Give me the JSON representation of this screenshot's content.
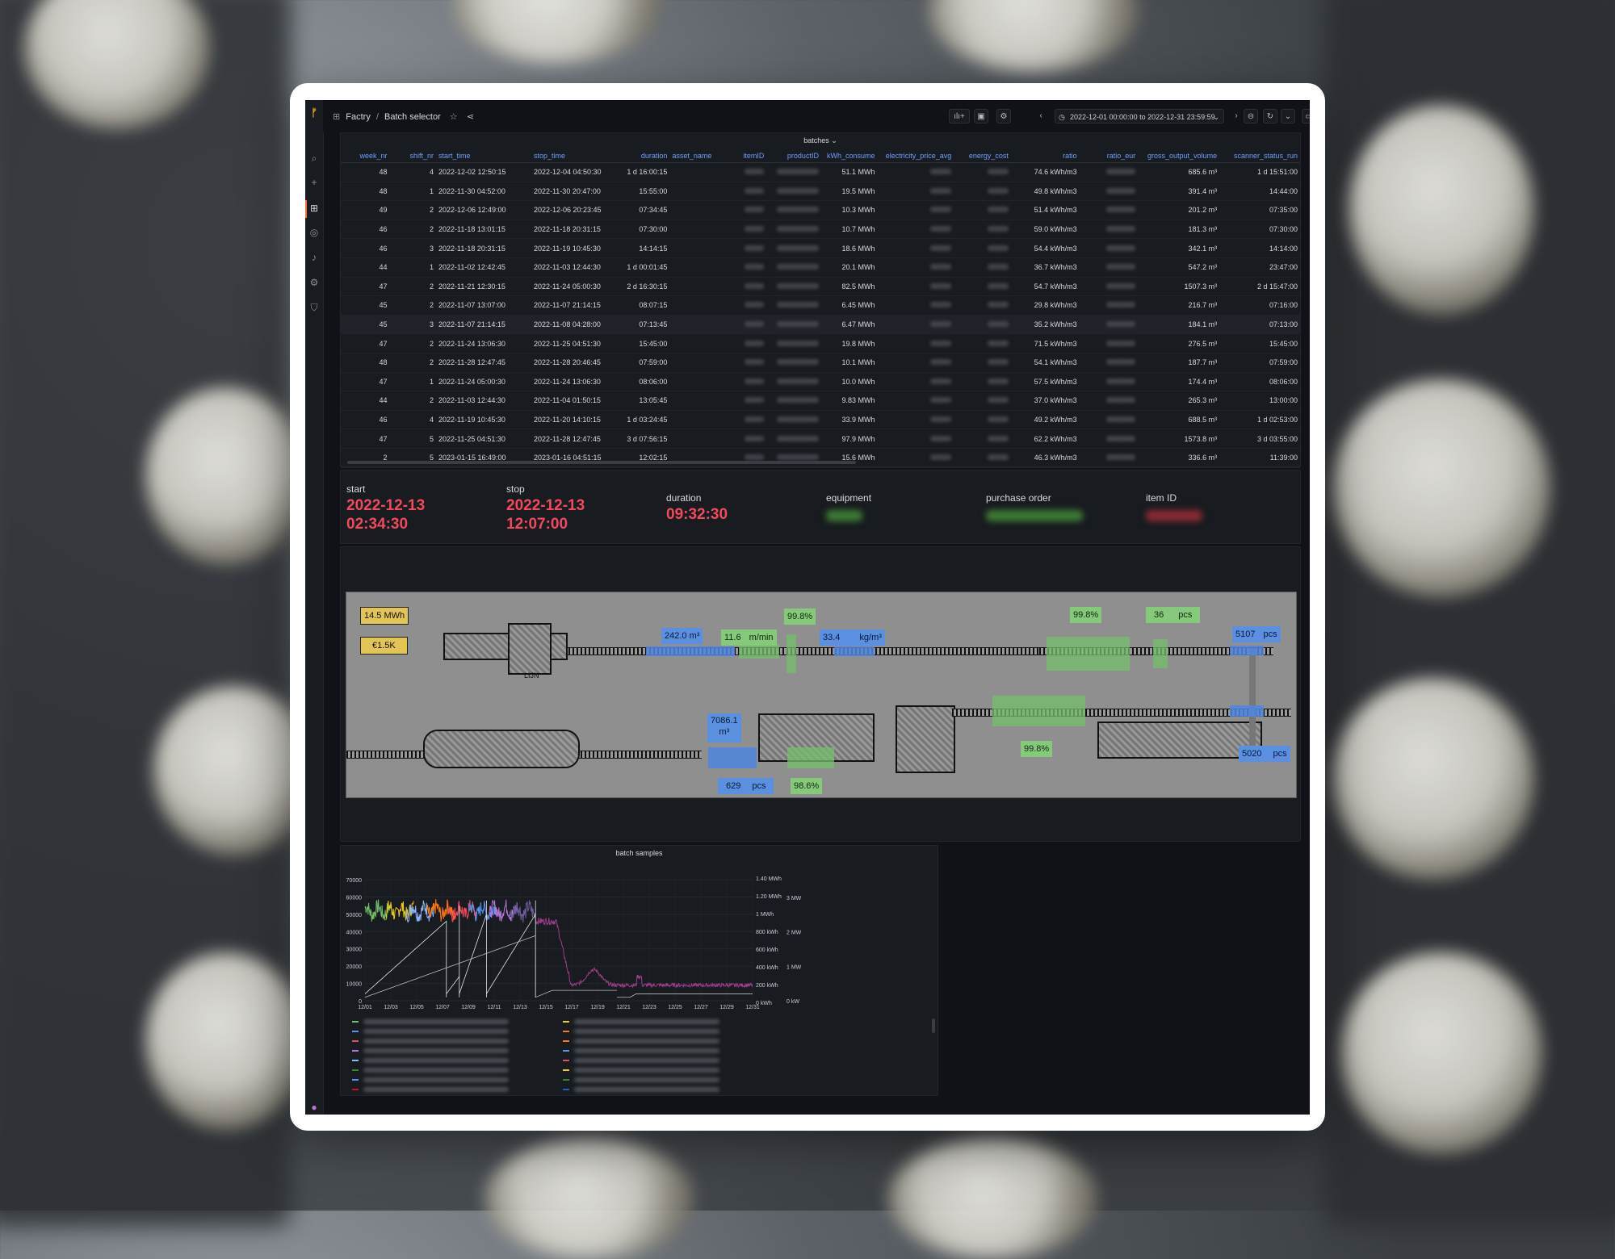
{
  "header": {
    "breadcrumb_root": "Factry",
    "breadcrumb_sep": "/",
    "breadcrumb_page": "Batch selector",
    "time_range": "2022-12-01 00:00:00 to 2022-12-31 23:59:59"
  },
  "table": {
    "title": "batches",
    "columns": [
      "week_nr",
      "shift_nr",
      "start_time",
      "stop_time",
      "duration",
      "asset_name",
      "itemID",
      "productID",
      "kWh_consume",
      "electricity_price_avg",
      "energy_cost",
      "ratio",
      "ratio_eur",
      "gross_output_volume",
      "scanner_status_run"
    ],
    "rows": [
      [
        "48",
        "4",
        "2022-12-02 12:50:15",
        "2022-12-04 04:50:30",
        "1 d 16:00:15",
        "51.1 MWh",
        "74.6 kWh/m3",
        "685.6 m³",
        "1 d 15:51:00"
      ],
      [
        "48",
        "1",
        "2022-11-30 04:52:00",
        "2022-11-30 20:47:00",
        "15:55:00",
        "19.5 MWh",
        "49.8 kWh/m3",
        "391.4 m³",
        "14:44:00"
      ],
      [
        "49",
        "2",
        "2022-12-06 12:49:00",
        "2022-12-06 20:23:45",
        "07:34:45",
        "10.3 MWh",
        "51.4 kWh/m3",
        "201.2 m³",
        "07:35:00"
      ],
      [
        "46",
        "2",
        "2022-11-18 13:01:15",
        "2022-11-18 20:31:15",
        "07:30:00",
        "10.7 MWh",
        "59.0 kWh/m3",
        "181.3 m³",
        "07:30:00"
      ],
      [
        "46",
        "3",
        "2022-11-18 20:31:15",
        "2022-11-19 10:45:30",
        "14:14:15",
        "18.6 MWh",
        "54.4 kWh/m3",
        "342.1 m³",
        "14:14:00"
      ],
      [
        "44",
        "1",
        "2022-11-02 12:42:45",
        "2022-11-03 12:44:30",
        "1 d 00:01:45",
        "20.1 MWh",
        "36.7 kWh/m3",
        "547.2 m³",
        "23:47:00"
      ],
      [
        "47",
        "2",
        "2022-11-21 12:30:15",
        "2022-11-24 05:00:30",
        "2 d 16:30:15",
        "82.5 MWh",
        "54.7 kWh/m3",
        "1507.3 m³",
        "2 d 15:47:00"
      ],
      [
        "45",
        "2",
        "2022-11-07 13:07:00",
        "2022-11-07 21:14:15",
        "08:07:15",
        "6.45 MWh",
        "29.8 kWh/m3",
        "216.7 m³",
        "07:16:00"
      ],
      [
        "45",
        "3",
        "2022-11-07 21:14:15",
        "2022-11-08 04:28:00",
        "07:13:45",
        "6.47 MWh",
        "35.2 kWh/m3",
        "184.1 m³",
        "07:13:00"
      ],
      [
        "47",
        "2",
        "2022-11-24 13:06:30",
        "2022-11-25 04:51:30",
        "15:45:00",
        "19.8 MWh",
        "71.5 kWh/m3",
        "276.5 m³",
        "15:45:00"
      ],
      [
        "48",
        "2",
        "2022-11-28 12:47:45",
        "2022-11-28 20:46:45",
        "07:59:00",
        "10.1 MWh",
        "54.1 kWh/m3",
        "187.7 m³",
        "07:59:00"
      ],
      [
        "47",
        "1",
        "2022-11-24 05:00:30",
        "2022-11-24 13:06:30",
        "08:06:00",
        "10.0 MWh",
        "57.5 kWh/m3",
        "174.4 m³",
        "08:06:00"
      ],
      [
        "44",
        "2",
        "2022-11-03 12:44:30",
        "2022-11-04 01:50:15",
        "13:05:45",
        "9.83 MWh",
        "37.0 kWh/m3",
        "265.3 m³",
        "13:00:00"
      ],
      [
        "46",
        "4",
        "2022-11-19 10:45:30",
        "2022-11-20 14:10:15",
        "1 d 03:24:45",
        "33.9 MWh",
        "49.2 kWh/m3",
        "688.5 m³",
        "1 d 02:53:00"
      ],
      [
        "47",
        "5",
        "2022-11-25 04:51:30",
        "2022-11-28 12:47:45",
        "3 d 07:56:15",
        "97.9 MWh",
        "62.2 kWh/m3",
        "1573.8 m³",
        "3 d 03:55:00"
      ],
      [
        "2",
        "5",
        "2023-01-15 16:49:00",
        "2023-01-16 04:51:15",
        "12:02:15",
        "15.6 MWh",
        "46.3 kWh/m3",
        "336.6 m³",
        "11:39:00"
      ]
    ]
  },
  "stats": {
    "start_label": "start",
    "start_date": "2022-12-13",
    "start_time": "02:34:30",
    "stop_label": "stop",
    "stop_date": "2022-12-13",
    "stop_time": "12:07:00",
    "duration_label": "duration",
    "duration_value": "09:32:30",
    "equipment_label": "equipment",
    "po_label": "purchase order",
    "item_label": "item ID"
  },
  "diagram": {
    "energy": "14.5 MWh",
    "cost": "€1.5K",
    "tags": {
      "volume_in": "242.0 m³",
      "speed": "11.6",
      "speed_unit": "m/min",
      "eff1": "99.8%",
      "density": "33.4",
      "density_unit": "kg/m³",
      "eff2": "99.8%",
      "count1": "36",
      "count1_unit": "pcs",
      "count2": "5107",
      "count2_unit": "pcs",
      "vol2_a": "7086.1",
      "vol2_b": "m³",
      "eff3": "99.8%",
      "count3": "5020",
      "count3_unit": "pcs",
      "count4": "629",
      "count4_unit": "pcs",
      "eff4": "98.6%"
    },
    "machine_label": "LIJN"
  },
  "chart_data": {
    "type": "line",
    "title": "batch samples",
    "x_ticks": [
      "12/01",
      "12/03",
      "12/05",
      "12/07",
      "12/09",
      "12/11",
      "12/13",
      "12/15",
      "12/17",
      "12/19",
      "12/21",
      "12/23",
      "12/25",
      "12/27",
      "12/29",
      "12/31"
    ],
    "y_left_ticks": [
      "70000",
      "60000",
      "50000",
      "40000",
      "30000",
      "20000",
      "10000",
      "0"
    ],
    "y_left_range": [
      0,
      70000
    ],
    "y_right1_ticks": [
      "1.40 MWh",
      "1.20 MWh",
      "1 MWh",
      "800 kWh",
      "600 kWh",
      "400 kWh",
      "200 kWh",
      "0 kWh"
    ],
    "y_right2_ticks": [
      "3 MW",
      "2 MW",
      "1 MW",
      "0 kW"
    ],
    "series_colors": [
      "#73bf69",
      "#f2cc0c",
      "#8ab8ff",
      "#ff780a",
      "#f2495c",
      "#5794f2",
      "#b877d9",
      "#705da0",
      "#37872d",
      "#fade2a",
      "#1f60c4",
      "#c4162a"
    ],
    "x_range_days": [
      1,
      31
    ]
  },
  "colors": {
    "accent_red": "#f2495c",
    "table_header": "#6e9fff",
    "panel_bg": "#181b1f"
  }
}
